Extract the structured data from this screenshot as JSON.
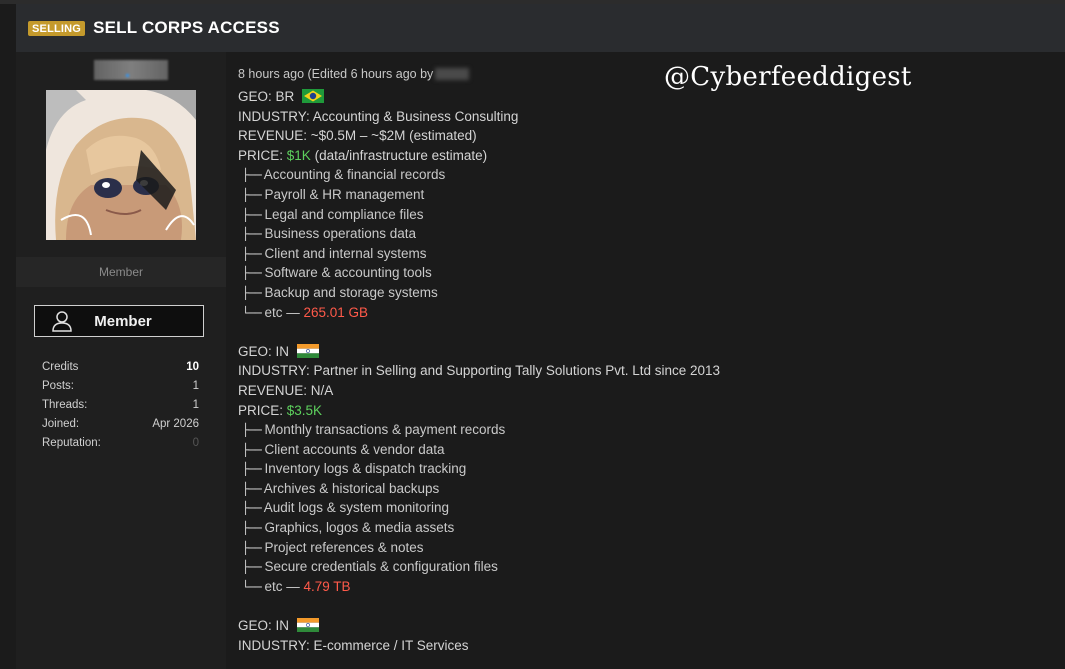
{
  "header": {
    "badge": "SELLING",
    "title": "SELL CORPS ACCESS"
  },
  "user": {
    "role_bar": "Member",
    "role_button": "Member",
    "stats": [
      {
        "label": "Credits",
        "value": "10"
      },
      {
        "label": "Posts:",
        "value": "1"
      },
      {
        "label": "Threads:",
        "value": "1"
      },
      {
        "label": "Joined:",
        "value": "Apr 2026"
      },
      {
        "label": "Reputation:",
        "value": "0"
      }
    ]
  },
  "post": {
    "meta": "8 hours ago (Edited 6 hours ago by",
    "watermark": "@Cyberfeeddigest",
    "listings": [
      {
        "geo": "GEO: BR",
        "industry": "INDUSTRY: Accounting & Business Consulting",
        "revenue": "REVENUE: ~$0.5M – ~$2M (estimated)",
        "price_label": "PRICE:",
        "price": "$1K",
        "price_note": "(data/infrastructure estimate)",
        "items": [
          "Accounting & financial records",
          "Payroll & HR management",
          "Legal and compliance files",
          "Business operations data",
          "Client and internal systems",
          "Software & accounting tools",
          "Backup and storage systems"
        ],
        "etc_label": "etc —",
        "size": "265.01 GB"
      },
      {
        "geo": "GEO: IN",
        "industry": "INDUSTRY: Partner in Selling and Supporting Tally Solutions Pvt. Ltd since 2013",
        "revenue": "REVENUE: N/A",
        "price_label": "PRICE:",
        "price": "$3.5K",
        "items": [
          "Monthly transactions & payment records",
          "Client accounts & vendor data",
          "Inventory logs & dispatch tracking",
          "Archives & historical backups",
          "Audit logs & system monitoring",
          "Graphics, logos & media assets",
          "Project references & notes",
          "Secure credentials & configuration files"
        ],
        "etc_label": "etc —",
        "size": "4.79 TB"
      },
      {
        "geo": "GEO: IN",
        "industry": "INDUSTRY: E-commerce / IT Services"
      }
    ]
  }
}
